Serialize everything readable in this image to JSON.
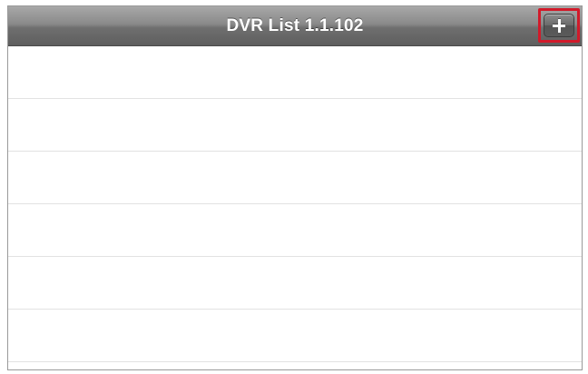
{
  "navbar": {
    "title": "DVR List 1.1.102",
    "add_button_icon": "plus-icon",
    "highlight_color": "#d11a2a"
  },
  "list": {
    "rows": [
      {
        "label": ""
      },
      {
        "label": ""
      },
      {
        "label": ""
      },
      {
        "label": ""
      },
      {
        "label": ""
      },
      {
        "label": ""
      }
    ]
  }
}
